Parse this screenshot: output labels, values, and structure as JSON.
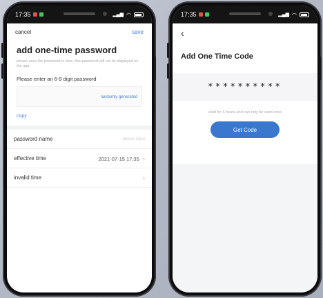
{
  "status": {
    "time": "17:35"
  },
  "left": {
    "cancel_label": "cancel",
    "save_label": "save",
    "title": "add one-time password",
    "note": "please save the password in time, this password will not be displayed on the app",
    "prompt": "Please enter an 6-9 digit password",
    "random_label": "randomly generated",
    "copy_label": "copy",
    "rows": {
      "name_label": "password name",
      "name_hint": "please input",
      "time_label": "effective time",
      "time_value": "2021-07-15 17:35",
      "invalid_label": "invalid time"
    }
  },
  "right": {
    "title": "Add One Time Code",
    "code": "**********",
    "valid_note": "valid for 6 hours and can only be used once",
    "button_label": "Get Code"
  },
  "colors": {
    "accent": "#3a78cf",
    "link": "#4a7fd1"
  }
}
